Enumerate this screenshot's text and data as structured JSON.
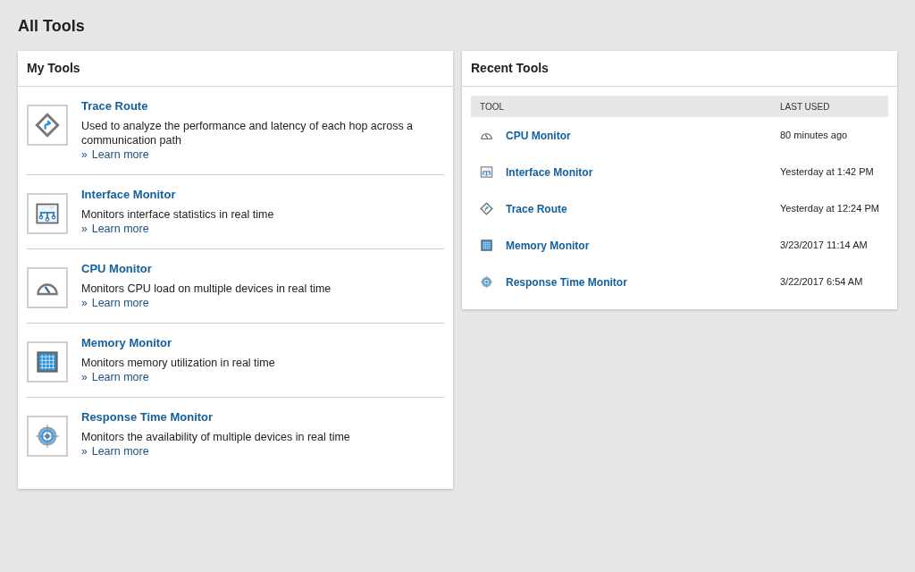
{
  "page_title": "All Tools",
  "my_tools": {
    "title": "My Tools",
    "items": [
      {
        "kind": "trace",
        "name": "Trace Route",
        "description": "Used to analyze the performance and latency of each hop across a communication path",
        "link_marker": "»",
        "link": "Learn more"
      },
      {
        "kind": "interface",
        "name": "Interface Monitor",
        "description": "Monitors interface statistics in real time",
        "link_marker": "»",
        "link": "Learn more"
      },
      {
        "kind": "cpu",
        "name": "CPU Monitor",
        "description": "Monitors CPU load on multiple devices in real time",
        "link_marker": "»",
        "link": "Learn more"
      },
      {
        "kind": "memory",
        "name": "Memory Monitor",
        "description": "Monitors memory utilization in real time",
        "link_marker": "»",
        "link": "Learn more"
      },
      {
        "kind": "response",
        "name": "Response Time Monitor",
        "description": "Monitors the availability of multiple devices in real time",
        "link_marker": "»",
        "link": "Learn more"
      }
    ]
  },
  "recent_tools": {
    "title": "Recent Tools",
    "columns": [
      "TOOL",
      "LAST USED"
    ],
    "rows": [
      {
        "kind": "cpu",
        "name": "CPU Monitor",
        "last_used": "80 minutes ago"
      },
      {
        "kind": "interface",
        "name": "Interface Monitor",
        "last_used": "Yesterday at 1:42 PM"
      },
      {
        "kind": "trace",
        "name": "Trace Route",
        "last_used": "Yesterday at 12:24 PM"
      },
      {
        "kind": "memory",
        "name": "Memory Monitor",
        "last_used": "3/23/2017 11:14 AM"
      },
      {
        "kind": "response",
        "name": "Response Time Monitor",
        "last_used": "3/22/2017 6:54 AM"
      }
    ]
  }
}
